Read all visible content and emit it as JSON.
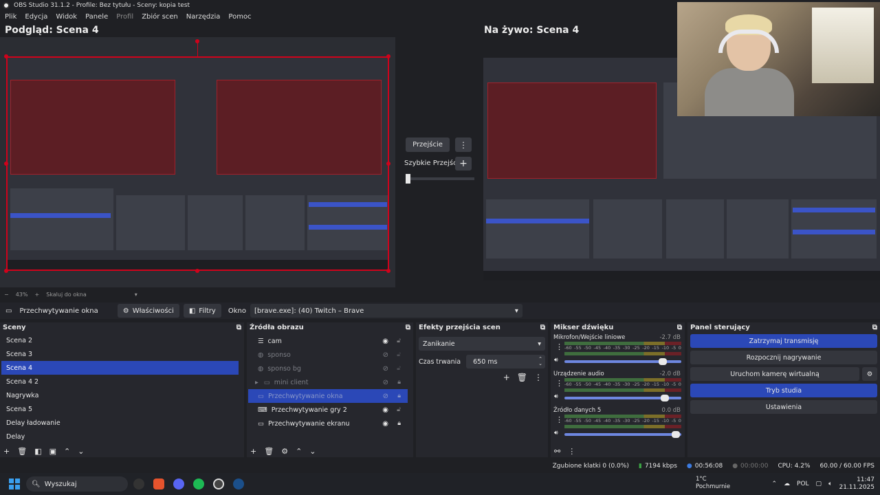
{
  "window": {
    "title": "OBS Studio 31.1.2 - Profile: Bez tytułu - Sceny: kopia test"
  },
  "menu": [
    "Plik",
    "Edycja",
    "Widok",
    "Panele",
    "Profil",
    "Zbiór scen",
    "Narzędzia",
    "Pomoc"
  ],
  "preview": {
    "label": "Podgląd: Scena 4",
    "zoom": "43%",
    "fit": "Skaluj do okna"
  },
  "live": {
    "label": "Na żywo: Scena 4"
  },
  "transition": {
    "button": "Przejście",
    "quick": "Szybkie Przejścia"
  },
  "sourcebar": {
    "source": "Przechwytywanie okna",
    "properties": "Właściwości",
    "filters": "Filtry",
    "window_label": "Okno",
    "window_value": "[brave.exe]: (40) Twitch – Brave"
  },
  "scenes": {
    "title": "Sceny",
    "items": [
      "Scena 2",
      "Scena 3",
      "Scena 4",
      "Scena 4 2",
      "Nagrywka",
      "Scena 5",
      "Delay ładowanie",
      "Delay"
    ],
    "selected_index": 2
  },
  "sources": {
    "title": "Źródła obrazu",
    "items": [
      {
        "name": "cam",
        "icon": "list-icon",
        "visible": true,
        "locked": false,
        "indent": false
      },
      {
        "name": "sponso",
        "icon": "browser-icon",
        "visible": false,
        "locked": false,
        "indent": false
      },
      {
        "name": "sponso bg",
        "icon": "browser-icon",
        "visible": false,
        "locked": false,
        "indent": false
      },
      {
        "name": "mini client",
        "icon": "folder-icon",
        "visible": false,
        "locked": true,
        "indent": true
      },
      {
        "name": "Przechwytywanie okna",
        "icon": "window-icon",
        "visible": false,
        "locked": true,
        "indent": false
      },
      {
        "name": "Przechwytywanie gry 2",
        "icon": "gamepad-icon",
        "visible": true,
        "locked": false,
        "indent": false
      },
      {
        "name": "Przechwytywanie ekranu",
        "icon": "monitor-icon",
        "visible": true,
        "locked": true,
        "indent": false
      }
    ],
    "selected_index": 4
  },
  "transitions": {
    "title": "Efekty przejścia scen",
    "type": "Zanikanie",
    "duration_label": "Czas trwania",
    "duration": "650 ms"
  },
  "mixer": {
    "title": "Mikser dźwięku",
    "scale": [
      "-60",
      "-55",
      "-50",
      "-45",
      "-40",
      "-35",
      "-30",
      "-25",
      "-20",
      "-15",
      "-10",
      "-5",
      "0"
    ],
    "channels": [
      {
        "name": "Mikrofon/Wejście liniowe",
        "db": "-2.7 dB",
        "volume": 0.84
      },
      {
        "name": "Urządzenie audio",
        "db": "-2.0 dB",
        "volume": 0.86
      },
      {
        "name": "Źródło danych 5",
        "db": "0.0 dB",
        "volume": 0.95
      }
    ]
  },
  "controls": {
    "title": "Panel sterujący",
    "buttons": [
      "Zatrzymaj transmisję",
      "Rozpocznij nagrywanie",
      "Uruchom kamerę wirtualną",
      "Tryb studia",
      "Ustawienia"
    ]
  },
  "status": {
    "dropped": "Zgubione klatki 0 (0.0%)",
    "bitrate": "7194 kbps",
    "stream_time": "00:56:08",
    "rec_time": "00:00:00",
    "cpu": "CPU: 4.2%",
    "fps": "60.00 / 60.00 FPS"
  },
  "taskbar": {
    "search": "Wyszukaj",
    "weather_temp": "1°C",
    "weather_desc": "Pochmurnie",
    "lang": "POL",
    "time": "11:47",
    "date": "21.11.2025"
  },
  "colors": {
    "accent": "#2b48b7",
    "selection_border": "#d0021b"
  }
}
